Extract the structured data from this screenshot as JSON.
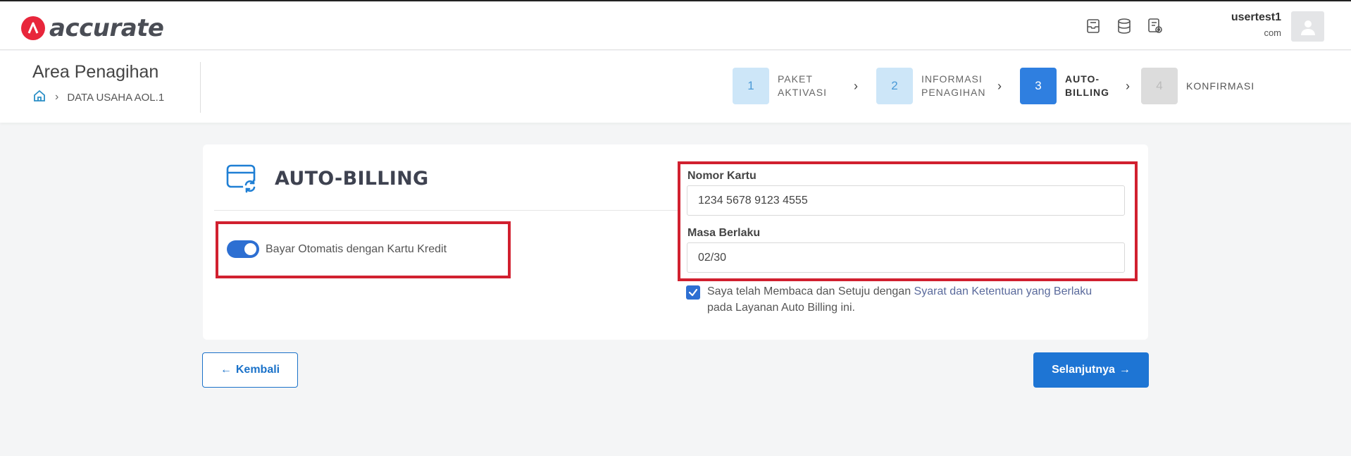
{
  "brand": {
    "name": "accurate",
    "accent": "#e8263b"
  },
  "header": {
    "icons": [
      "inbox-icon",
      "database-icon",
      "document-settings-icon"
    ],
    "user": {
      "name": "usertest1",
      "email": "com"
    }
  },
  "page": {
    "title": "Area Penagihan",
    "breadcrumb": {
      "home_icon": "home-icon",
      "item": "DATA USAHA AOL.1"
    }
  },
  "steps": [
    {
      "num": "1",
      "line1": "PAKET",
      "line2": "AKTIVASI",
      "state": "done"
    },
    {
      "num": "2",
      "line1": "INFORMASI",
      "line2": "PENAGIHAN",
      "state": "done"
    },
    {
      "num": "3",
      "line1": "AUTO-",
      "line2": "BILLING",
      "state": "active"
    },
    {
      "num": "4",
      "line1": "KONFIRMASI",
      "line2": "",
      "state": "pending"
    }
  ],
  "card": {
    "title": "AUTO-BILLING",
    "icon": "card-sync-icon",
    "toggle": {
      "label": "Bayar Otomatis dengan Kartu Kredit",
      "on": true
    },
    "card_number": {
      "label": "Nomor Kartu",
      "value": "1234 5678 9123 4555"
    },
    "expiry": {
      "label": "Masa Berlaku",
      "value": "02/30"
    },
    "agree": {
      "checked": true,
      "text_before": "Saya telah Membaca dan Setuju dengan ",
      "link": "Syarat dan Ketentuan yang Berlaku",
      "text_after": " pada Layanan Auto Billing ini."
    }
  },
  "actions": {
    "back_label": "Kembali",
    "next_label": "Selanjutnya"
  },
  "colors": {
    "primary": "#1e75d4",
    "highlight": "#d1202f",
    "step_active": "#2f7fe0",
    "step_done": "#cde6f8"
  }
}
